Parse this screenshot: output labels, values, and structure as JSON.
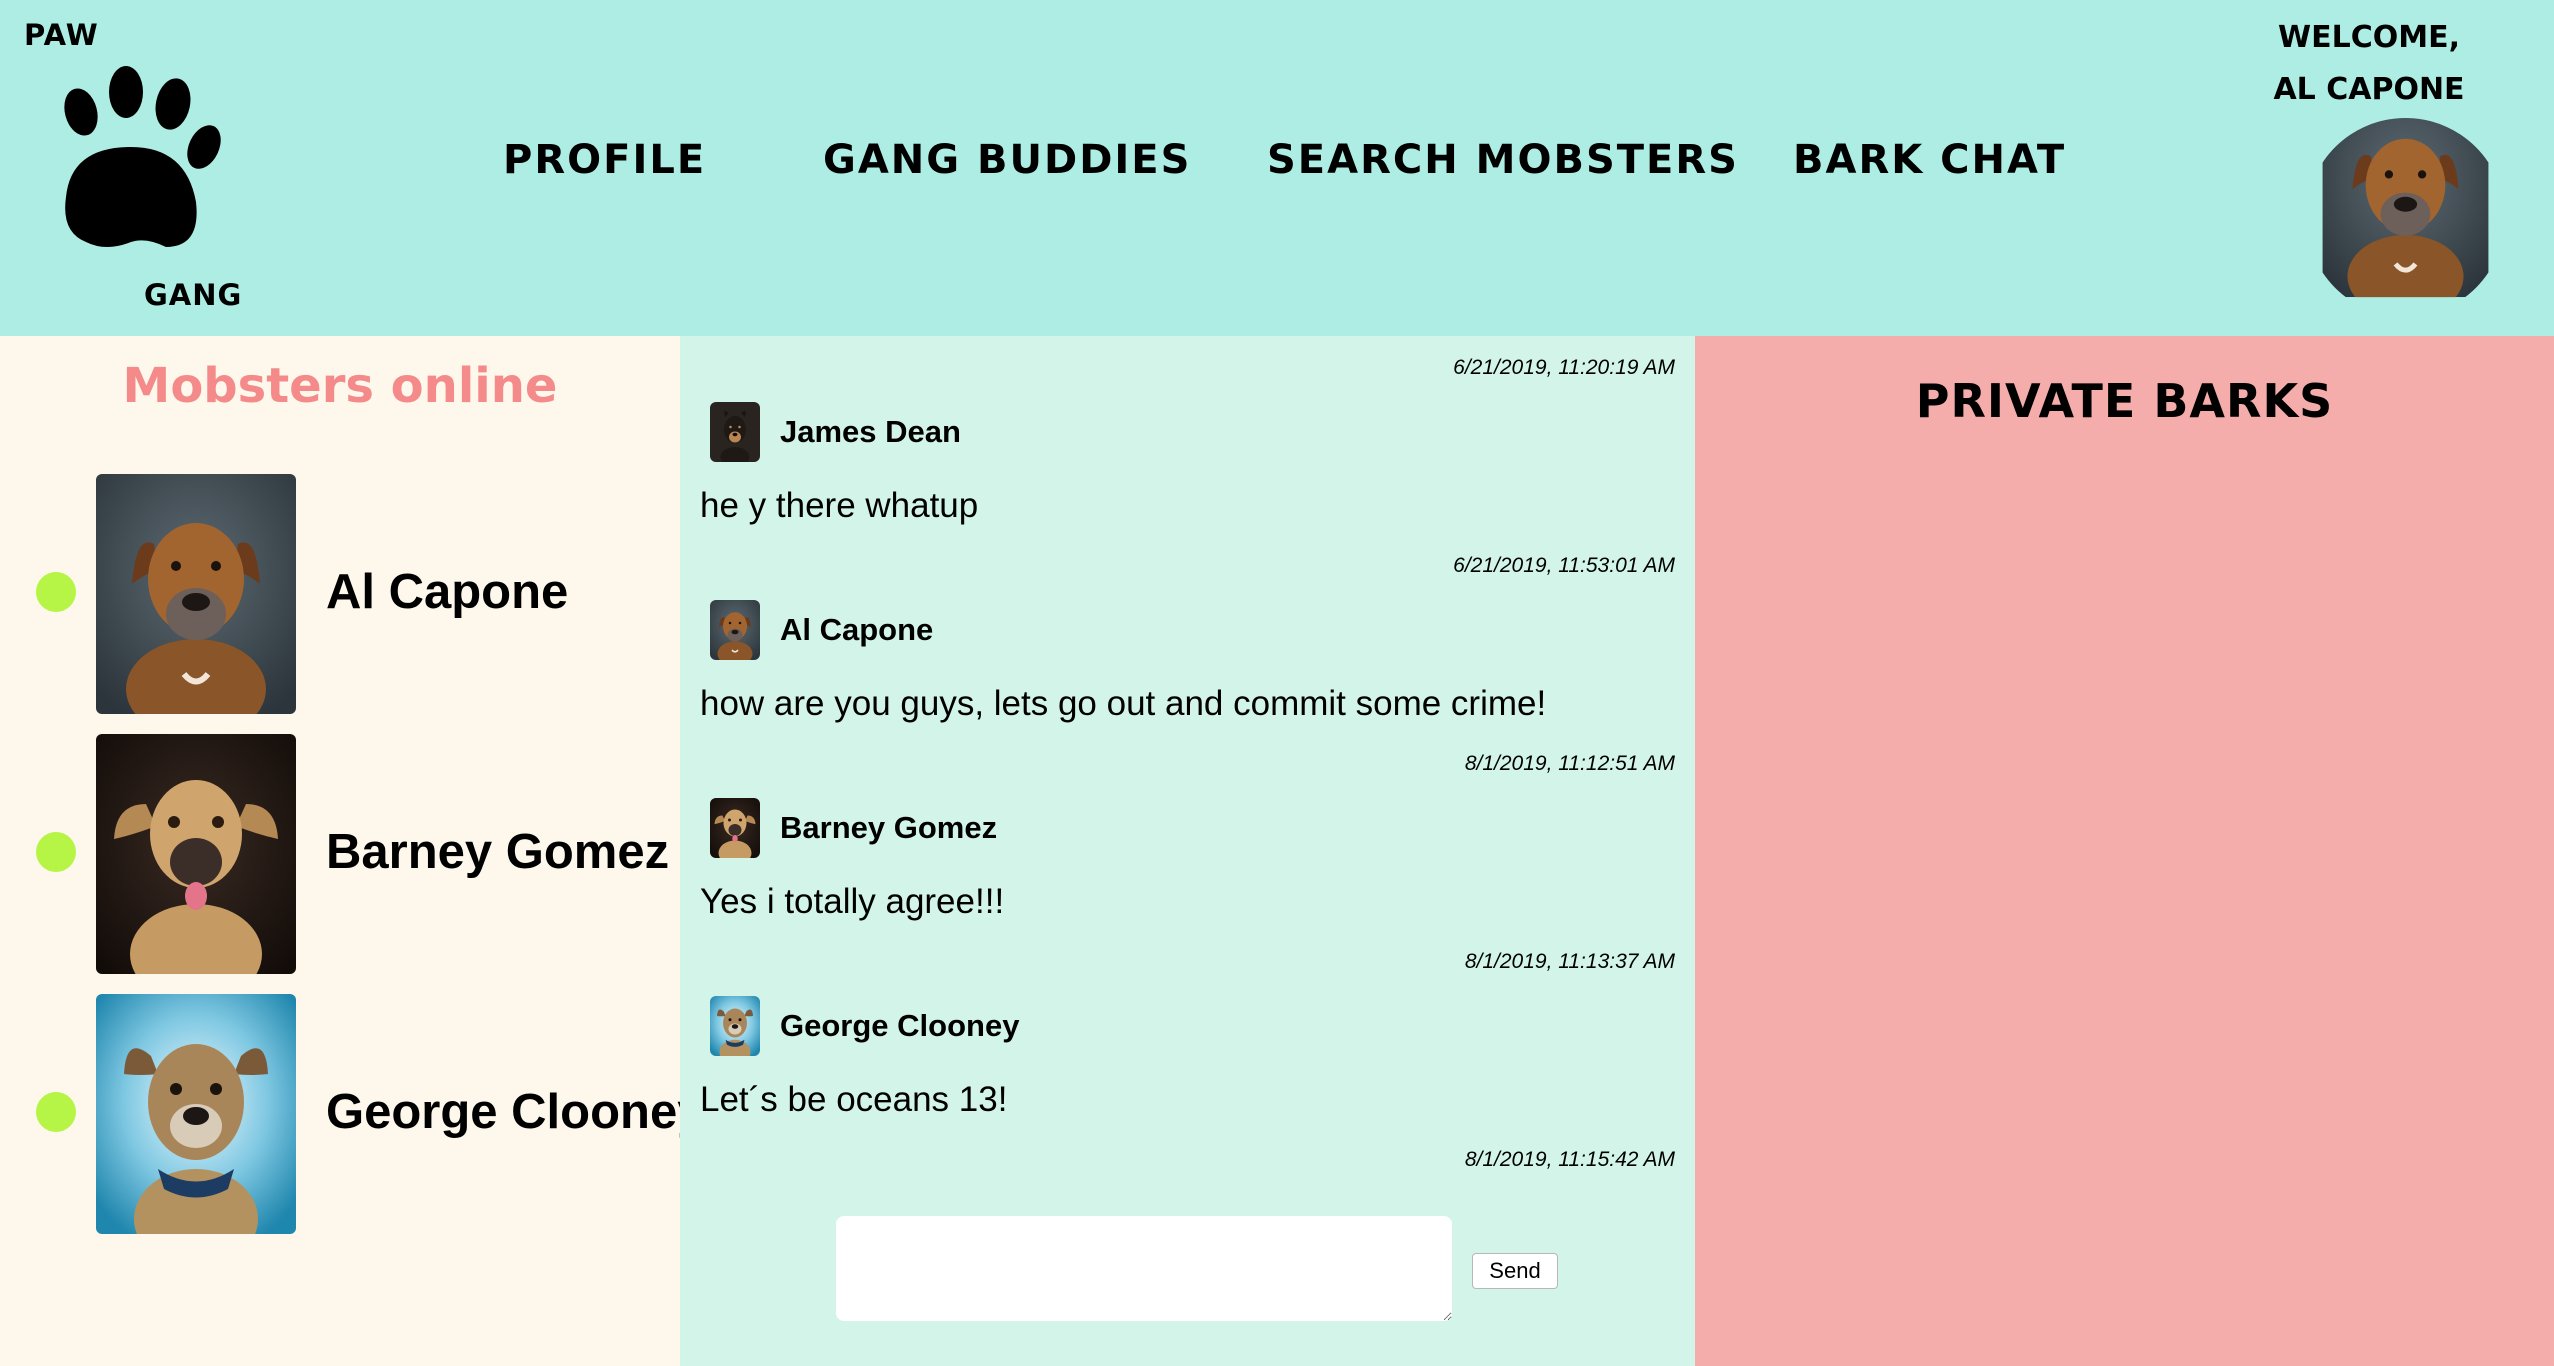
{
  "header": {
    "logo_top": "PAW",
    "logo_bottom": "GANG",
    "nav": [
      "PROFILE",
      "GANG BUDDIES",
      "SEARCH MOBSTERS",
      "BARK CHAT"
    ],
    "welcome_line1": "WELCOME,",
    "welcome_line2": "AL CAPONE"
  },
  "online": {
    "title": "Mobsters online",
    "members": [
      {
        "name": "Al Capone",
        "status_color": "#b6f446"
      },
      {
        "name": "Barney Gomez",
        "status_color": "#b6f446"
      },
      {
        "name": "George Clooney",
        "status_color": "#b6f446"
      }
    ]
  },
  "chat": {
    "messages": [
      {
        "time": "6/21/2019, 11:20:19 AM",
        "author": "James Dean",
        "text": "he y there whatup"
      },
      {
        "time": "6/21/2019, 11:53:01 AM",
        "author": "Al Capone",
        "text": "how are you guys, lets go out and commit some crime!"
      },
      {
        "time": "8/1/2019, 11:12:51 AM",
        "author": "Barney Gomez",
        "text": "Yes i totally agree!!!"
      },
      {
        "time": "8/1/2019, 11:13:37 AM",
        "author": "George Clooney",
        "text": "Let´s be oceans 13!"
      }
    ],
    "last_time": "8/1/2019, 11:15:42 AM",
    "input_value": "",
    "send_label": "Send"
  },
  "private": {
    "title": "PRIVATE BARKS"
  },
  "colors": {
    "header_bg": "#adede3",
    "left_bg": "#fdf8eb",
    "chat_bg": "#d3f4e8",
    "private_bg": "#f4adab",
    "accent_title": "#f48a8a",
    "online_dot": "#b6f446"
  }
}
